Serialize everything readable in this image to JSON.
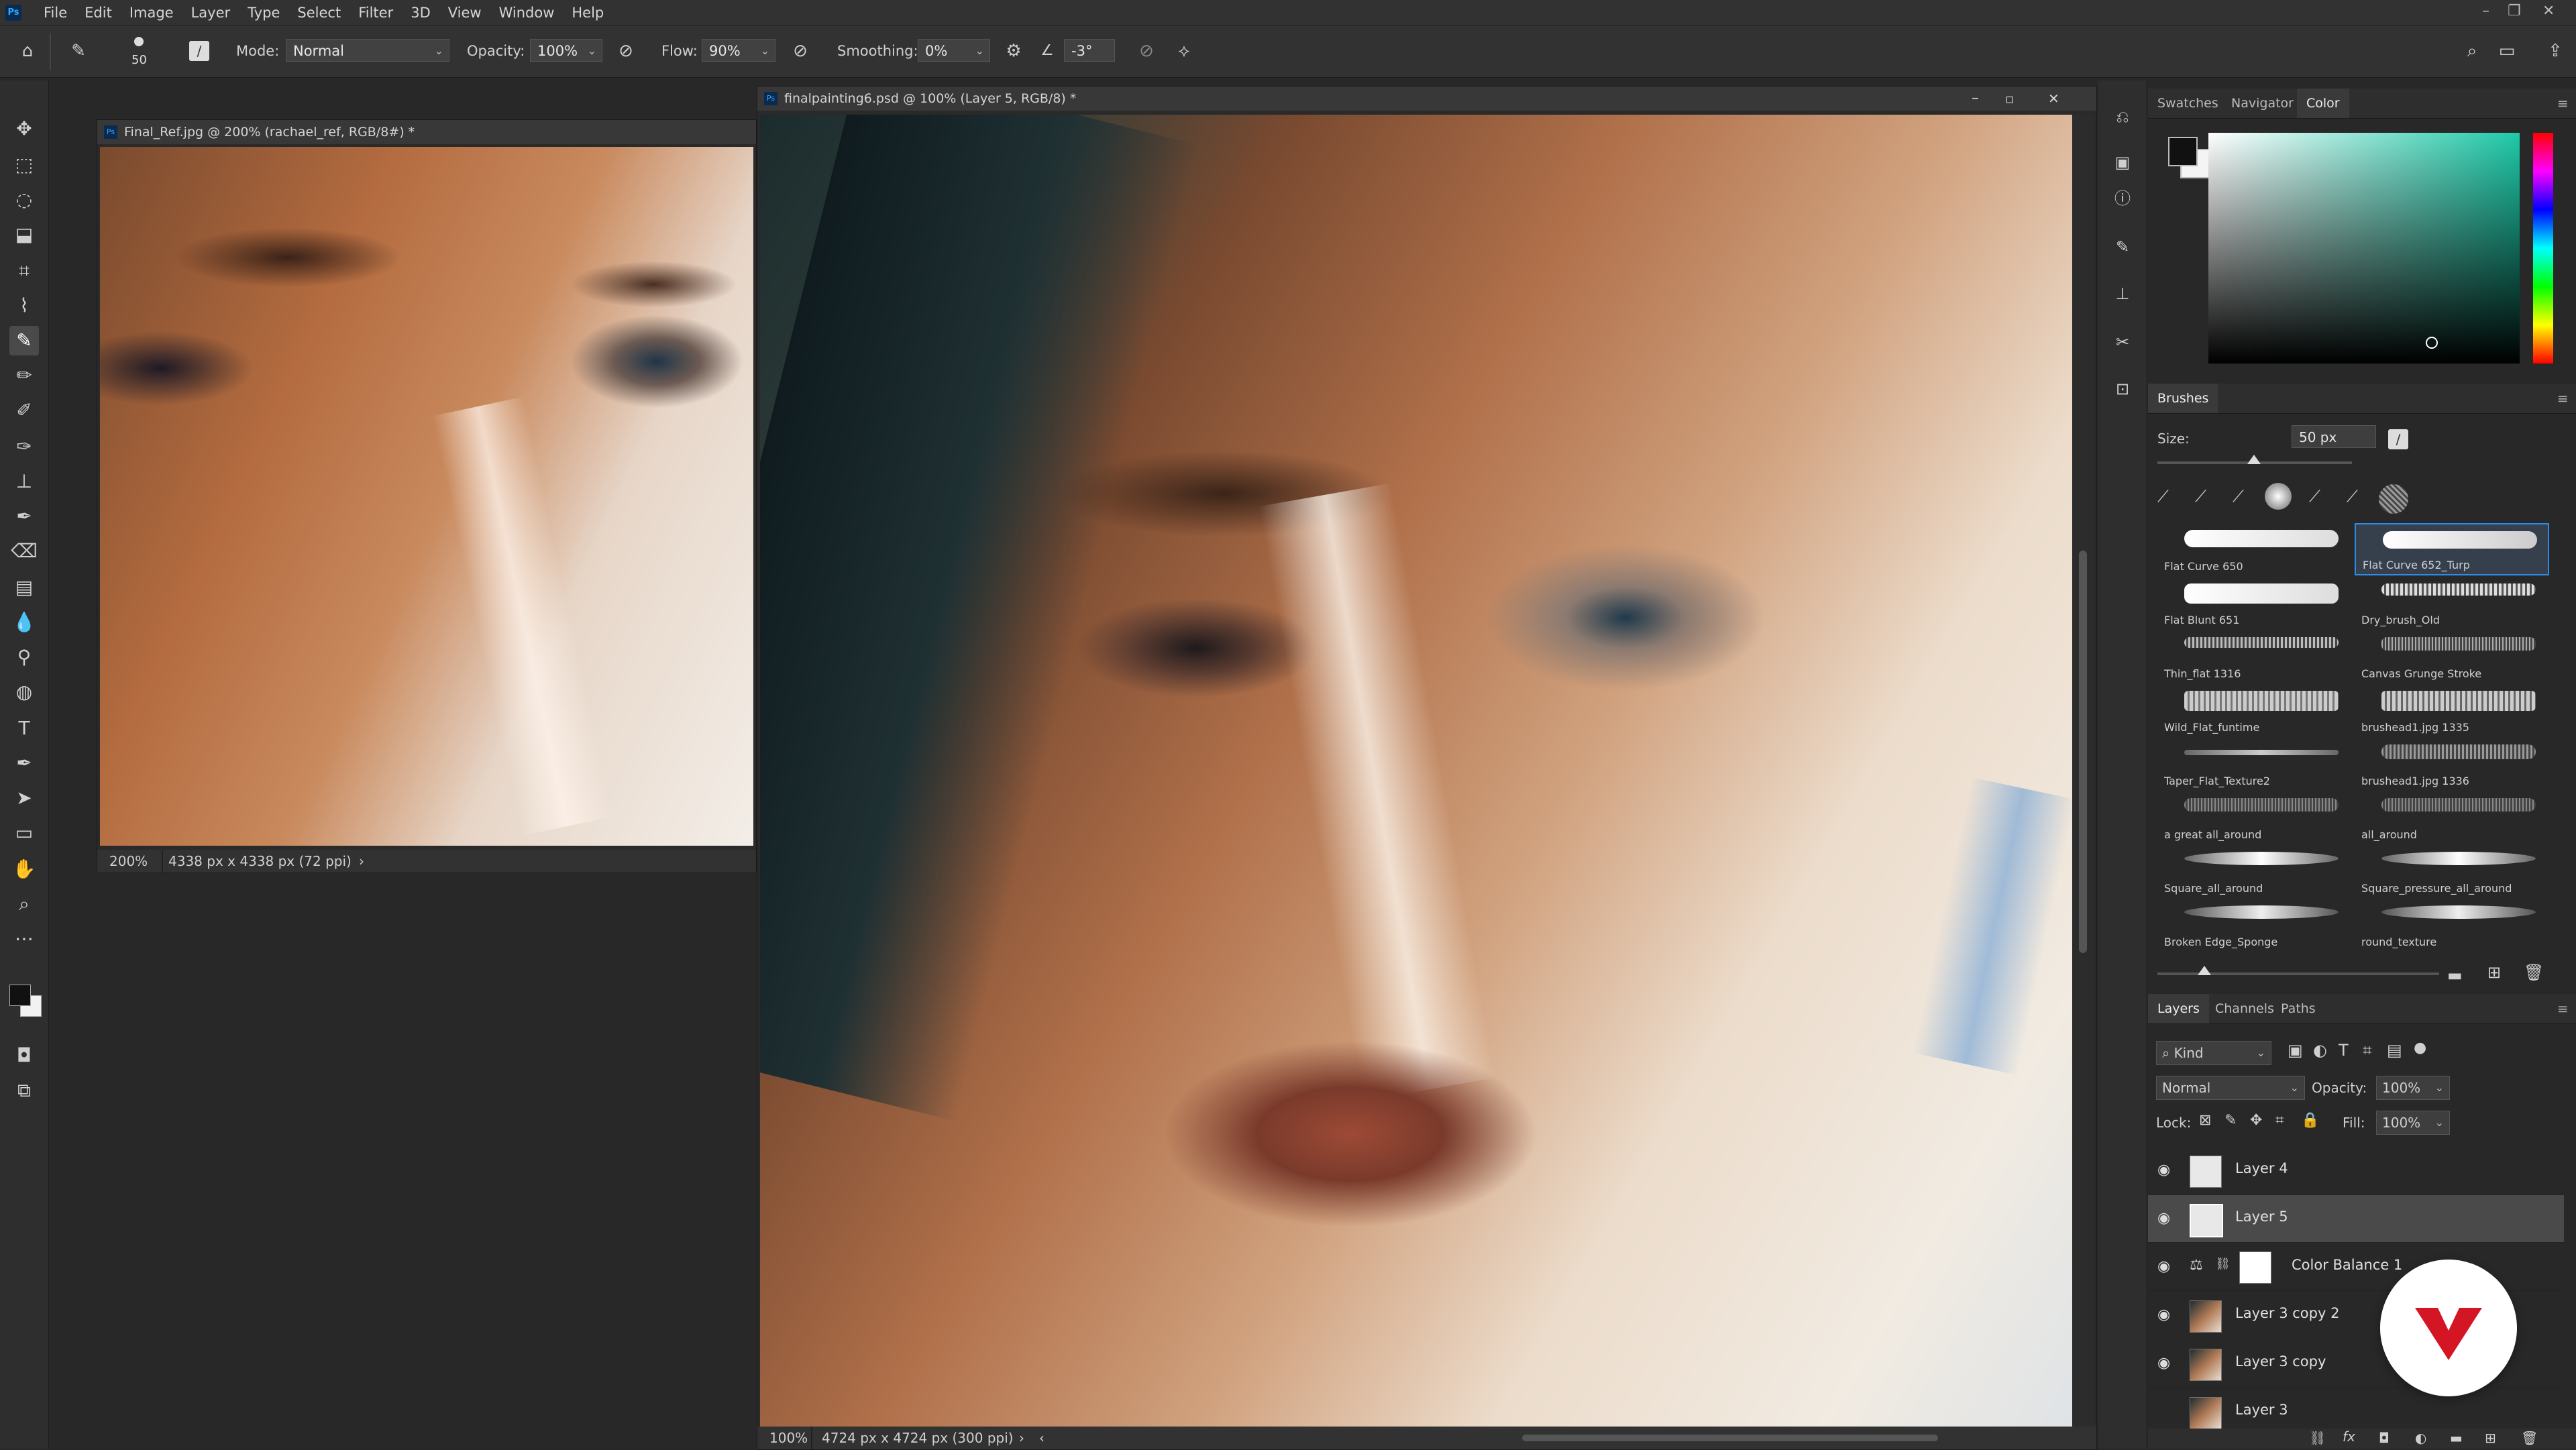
{
  "menubar": {
    "items": [
      "File",
      "Edit",
      "Image",
      "Layer",
      "Type",
      "Select",
      "Filter",
      "3D",
      "View",
      "Window",
      "Help"
    ]
  },
  "options": {
    "brush_size": "50",
    "mode_label": "Mode:",
    "mode_value": "Normal",
    "opacity_label": "Opacity:",
    "opacity_value": "100%",
    "flow_label": "Flow:",
    "flow_value": "90%",
    "smoothing_label": "Smoothing:",
    "smoothing_value": "0%",
    "angle_value": "-3°"
  },
  "ref_doc": {
    "title": "Final_Ref.jpg @ 200% (rachael_ref, RGB/8#) *",
    "zoom": "200%",
    "size": "4338 px x 4338 px (72 ppi)"
  },
  "main_doc": {
    "title": "finalpainting6.psd @ 100% (Layer 5, RGB/8) *",
    "zoom": "100%",
    "size": "4724 px x 4724 px (300 ppi)"
  },
  "color_panel": {
    "tabs": [
      "Swatches",
      "Navigator",
      "Color"
    ],
    "active_tab": "Color"
  },
  "brushes_panel": {
    "title": "Brushes",
    "size_label": "Size:",
    "size_value": "50 px",
    "brushes": [
      {
        "name": "Flat Curve 650"
      },
      {
        "name": "Flat Curve 652_Turp",
        "selected": true
      },
      {
        "name": "Flat Blunt 651"
      },
      {
        "name": "Dry_brush_Old"
      },
      {
        "name": "Thin_flat 1316"
      },
      {
        "name": "Canvas Grunge Stroke"
      },
      {
        "name": "Wild_Flat_funtime"
      },
      {
        "name": "brushead1.jpg 1335"
      },
      {
        "name": "Taper_Flat_Texture2"
      },
      {
        "name": "brushead1.jpg 1336"
      },
      {
        "name": "a great all_around"
      },
      {
        "name": "all_around"
      },
      {
        "name": "Square_all_around"
      },
      {
        "name": "Square_pressure_all_around"
      },
      {
        "name": "Broken Edge_Sponge"
      },
      {
        "name": "round_texture"
      }
    ]
  },
  "layers_panel": {
    "tabs": [
      "Layers",
      "Channels",
      "Paths"
    ],
    "filter_kind": "Kind",
    "blend_mode": "Normal",
    "opacity_label": "Opacity:",
    "opacity_value": "100%",
    "lock_label": "Lock:",
    "fill_label": "Fill:",
    "fill_value": "100%",
    "layers": [
      {
        "name": "Layer 4",
        "selected": false
      },
      {
        "name": "Layer 5",
        "selected": true
      },
      {
        "name": "Color Balance 1",
        "selected": false
      },
      {
        "name": "Layer 3 copy 2",
        "selected": false
      },
      {
        "name": "Layer 3 copy",
        "selected": false
      },
      {
        "name": "Layer 3",
        "selected": false
      }
    ]
  }
}
